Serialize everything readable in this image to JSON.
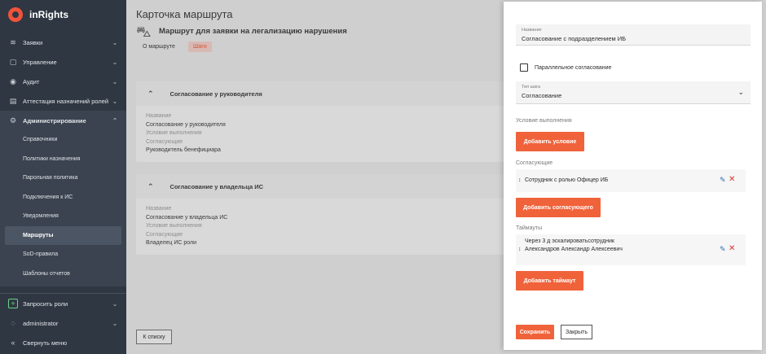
{
  "app": {
    "name": "inRights"
  },
  "sidebar": {
    "items": [
      {
        "label": "Заявки"
      },
      {
        "label": "Управление"
      },
      {
        "label": "Аудит"
      },
      {
        "label": "Аттестация назначений ролей"
      },
      {
        "label": "Администрирование"
      }
    ],
    "admin_sub": [
      "Справочники",
      "Политики назначения",
      "Парольная политика",
      "Подключения к ИС",
      "Уведомления",
      "Маршруты",
      "SoD-правила",
      "Шаблоны отчетов"
    ],
    "bottom": [
      {
        "label": "Запросить роли"
      },
      {
        "label": "administrator"
      },
      {
        "label": "Свернуть меню"
      }
    ]
  },
  "main": {
    "page_title": "Карточка маршрута",
    "route_name": "Маршрут для заявки на легализацию нарушения",
    "tabs": [
      "О маршруте",
      "Шаги"
    ],
    "steps": [
      {
        "title": "Согласование у руководителя",
        "name_label": "Название",
        "name_value": "Согласование у руководителя",
        "condition_label": "Условие выполнения",
        "approvers_label": "Согласующие",
        "approvers_value": "Руководитель бенефициара"
      },
      {
        "title": "Согласование у владельца ИС",
        "name_label": "Название",
        "name_value": "Согласование у владельца ИС",
        "condition_label": "Условие выполнения",
        "approvers_label": "Согласующие",
        "approvers_value": "Владелец ИС роли"
      }
    ],
    "back_label": "К списку"
  },
  "panel": {
    "name_label": "Название",
    "name_value": "Согласование с подразделением ИБ",
    "parallel_label": "Параллельное согласование",
    "step_type_label": "Тип шага",
    "step_type_value": "Согласование",
    "condition_section": "Условие выполнения",
    "add_condition": "Добавить условие",
    "approvers_section": "Согласующие",
    "approver_row": "Сотрудник с ролью Офицер ИБ",
    "add_approver": "Добавить согласующего",
    "timeouts_section": "Таймауты",
    "timeout_line1": "Через 3 д эскалироватьсотрудник",
    "timeout_line2": "Александров Александр Алексеевич",
    "add_timeout": "Добавить таймаут",
    "save": "Сохранить",
    "close": "Закрыть"
  }
}
